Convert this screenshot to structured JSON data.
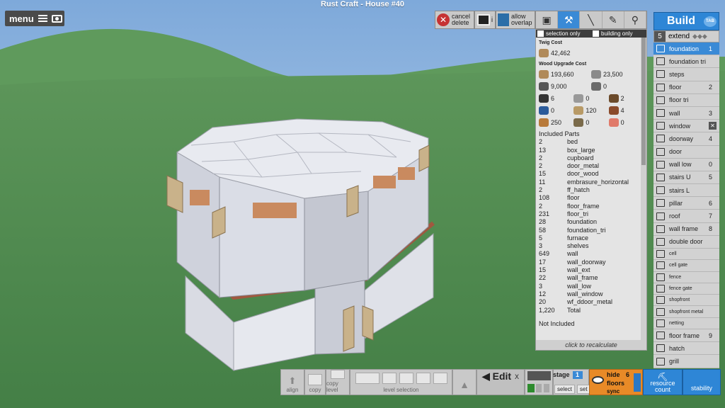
{
  "window": {
    "title": "Rust Craft - House #40"
  },
  "menu": {
    "label": "menu"
  },
  "toolbar": {
    "cancel_delete": "cancel delete",
    "cancel_line1": "cancel",
    "cancel_line2": "delete",
    "camera_suffix": "i",
    "allow_line1": "allow",
    "allow_line2": "overlap",
    "tool_icons": [
      "cube-icon",
      "hammer-icon",
      "pen-icon",
      "wrench-icon",
      "hatchet-icon"
    ],
    "active_tool": "hammer-icon"
  },
  "info_panel": {
    "filter_selection": "selection only",
    "filter_building": "building only",
    "twig_cost_header": "Twig Cost",
    "twig_cost": "42,462",
    "wood_upgrade_header": "Wood Upgrade Cost",
    "costs": [
      [
        {
          "icon": "wood-icon",
          "value": "193,660"
        },
        {
          "icon": "stone-icon",
          "value": "23,500"
        }
      ],
      [
        {
          "icon": "metal-frags-icon",
          "value": "9,000"
        },
        {
          "icon": "hqm-icon",
          "value": "0"
        }
      ],
      [
        {
          "icon": "gears-icon",
          "value": "6"
        },
        {
          "icon": "sheet-metal-icon",
          "value": "0"
        },
        {
          "icon": "rope-icon",
          "value": "2"
        }
      ],
      [
        {
          "icon": "tarp-icon",
          "value": "0"
        },
        {
          "icon": "cloth-icon",
          "value": "120"
        },
        {
          "icon": "lantern-icon",
          "value": "4"
        }
      ],
      [
        {
          "icon": "leather-icon",
          "value": "250"
        },
        {
          "icon": "tech-trash-icon",
          "value": "0"
        },
        {
          "icon": "low-grade-icon",
          "value": "0"
        }
      ]
    ],
    "included_header": "Included Parts",
    "parts": [
      {
        "qty": "2",
        "name": "bed"
      },
      {
        "qty": "13",
        "name": "box_large"
      },
      {
        "qty": "2",
        "name": "cupboard"
      },
      {
        "qty": "2",
        "name": "door_metal"
      },
      {
        "qty": "15",
        "name": "door_wood"
      },
      {
        "qty": "11",
        "name": "embrasure_horizontal"
      },
      {
        "qty": "2",
        "name": "ff_hatch"
      },
      {
        "qty": "108",
        "name": "floor"
      },
      {
        "qty": "2",
        "name": "floor_frame"
      },
      {
        "qty": "231",
        "name": "floor_tri"
      },
      {
        "qty": "28",
        "name": "foundation"
      },
      {
        "qty": "58",
        "name": "foundation_tri"
      },
      {
        "qty": "5",
        "name": "furnace"
      },
      {
        "qty": "3",
        "name": "shelves"
      },
      {
        "qty": "649",
        "name": "wall"
      },
      {
        "qty": "17",
        "name": "wall_doorway"
      },
      {
        "qty": "15",
        "name": "wall_ext"
      },
      {
        "qty": "22",
        "name": "wall_frame"
      },
      {
        "qty": "3",
        "name": "wall_low"
      },
      {
        "qty": "12",
        "name": "wall_window"
      },
      {
        "qty": "20",
        "name": "wf_ddoor_metal"
      },
      {
        "qty": "1,220",
        "name": "Total"
      }
    ],
    "not_included": "Not Included",
    "recalc": "click to recalculate"
  },
  "build": {
    "title": "Build",
    "tab_hint": "TAB",
    "extend_count": "5",
    "extend_label": "extend",
    "items": [
      {
        "label": "foundation",
        "key": "1",
        "selected": true,
        "small": false,
        "icon": "foundation-icon"
      },
      {
        "label": "foundation tri",
        "key": "",
        "selected": false,
        "small": false,
        "icon": "foundation-tri-icon"
      },
      {
        "label": "steps",
        "key": "",
        "selected": false,
        "small": false,
        "icon": "steps-icon"
      },
      {
        "label": "floor",
        "key": "2",
        "selected": false,
        "small": false,
        "icon": "floor-icon"
      },
      {
        "label": "floor tri",
        "key": "",
        "selected": false,
        "small": false,
        "icon": "floor-tri-icon"
      },
      {
        "label": "wall",
        "key": "3",
        "selected": false,
        "small": false,
        "icon": "wall-icon"
      },
      {
        "label": "window",
        "key": "",
        "selected": false,
        "small": false,
        "icon": "window-icon",
        "x": true
      },
      {
        "label": "doorway",
        "key": "4",
        "selected": false,
        "small": false,
        "icon": "doorway-icon"
      },
      {
        "label": "door",
        "key": "",
        "selected": false,
        "small": false,
        "icon": "door-icon"
      },
      {
        "label": "wall low",
        "key": "0",
        "selected": false,
        "small": false,
        "icon": "wall-low-icon"
      },
      {
        "label": "stairs U",
        "key": "5",
        "selected": false,
        "small": false,
        "icon": "stairs-u-icon"
      },
      {
        "label": "stairs L",
        "key": "",
        "selected": false,
        "small": false,
        "icon": "stairs-l-icon"
      },
      {
        "label": "pillar",
        "key": "6",
        "selected": false,
        "small": false,
        "icon": "pillar-icon"
      },
      {
        "label": "roof",
        "key": "7",
        "selected": false,
        "small": false,
        "icon": "roof-icon"
      },
      {
        "label": "wall frame",
        "key": "8",
        "selected": false,
        "small": false,
        "icon": "wall-frame-icon"
      },
      {
        "label": "double door",
        "key": "",
        "selected": false,
        "small": false,
        "icon": "double-door-icon"
      },
      {
        "label": "cell",
        "key": "",
        "selected": false,
        "small": true,
        "icon": "cell-icon"
      },
      {
        "label": "cell gate",
        "key": "",
        "selected": false,
        "small": true,
        "icon": "cell-gate-icon"
      },
      {
        "label": "fence",
        "key": "",
        "selected": false,
        "small": true,
        "icon": "fence-icon"
      },
      {
        "label": "fence gate",
        "key": "",
        "selected": false,
        "small": true,
        "icon": "fence-gate-icon"
      },
      {
        "label": "shopfront",
        "key": "",
        "selected": false,
        "small": true,
        "icon": "shopfront-icon"
      },
      {
        "label": "shopfront metal",
        "key": "",
        "selected": false,
        "small": true,
        "icon": "shopfront-metal-icon"
      },
      {
        "label": "netting",
        "key": "",
        "selected": false,
        "small": true,
        "icon": "netting-icon"
      },
      {
        "label": "floor frame",
        "key": "9",
        "selected": false,
        "small": false,
        "icon": "floor-frame-icon"
      },
      {
        "label": "hatch",
        "key": "",
        "selected": false,
        "small": false,
        "icon": "hatch-icon"
      },
      {
        "label": "grill",
        "key": "",
        "selected": false,
        "small": false,
        "icon": "grill-icon"
      }
    ]
  },
  "bottom": {
    "align": "align",
    "copy": "copy",
    "copy_level": "copy level",
    "level_selection": "level selection",
    "edit": "Edit",
    "edit_x": "X",
    "stage_label": "stage",
    "stage_value": "1",
    "select": "select",
    "set": "set",
    "hide": "hide",
    "floors": "floors",
    "sync": "sync",
    "floors_count": "6",
    "resource_count_line1": "resource",
    "resource_count_line2": "count",
    "stability": "stability"
  },
  "colors": {
    "accent": "#2e86d6",
    "orange": "#e88a27",
    "danger": "#c63232",
    "grass": "#4e8a4e",
    "sky": "#8fb7e0"
  }
}
